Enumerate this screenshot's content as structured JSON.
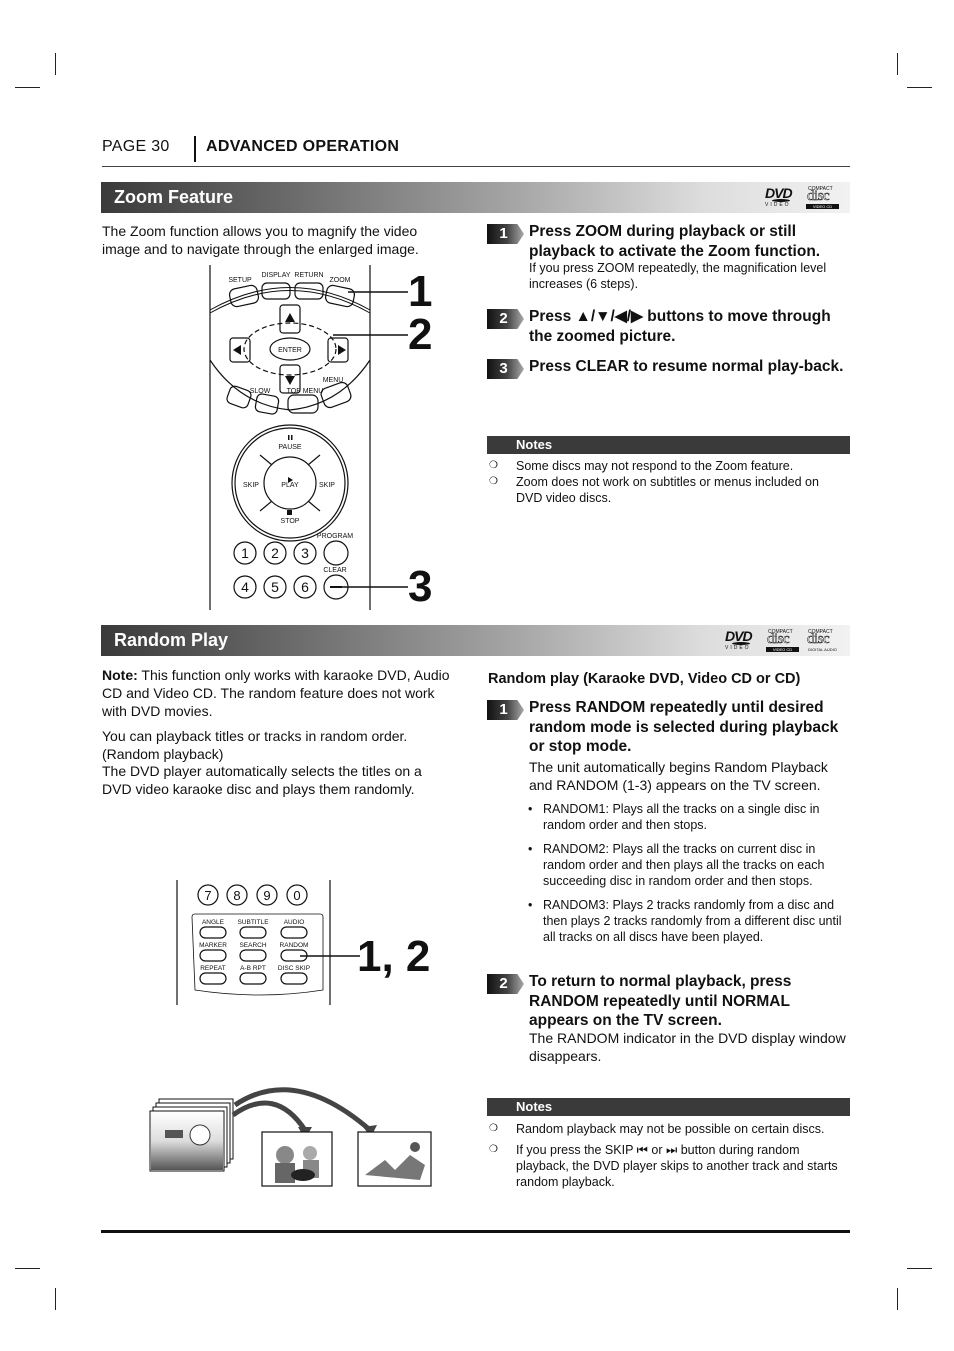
{
  "header": {
    "page_label": "PAGE 30",
    "section_title": "ADVANCED OPERATION"
  },
  "zoom_section": {
    "title": "Zoom Feature",
    "disc_logos": [
      "dvd-video-logo",
      "compact-disc-video-cd-logo"
    ],
    "intro": "The Zoom function allows you to magnify the video image and to navigate through the enlarged image.",
    "remote_labels": {
      "top_buttons": [
        "SETUP",
        "DISPLAY",
        "RETURN",
        "ZOOM"
      ],
      "enter": "ENTER",
      "slow": "SLOW",
      "top_menu": "TOP MENU",
      "menu": "MENU",
      "pause": "PAUSE",
      "play": "PLAY",
      "skip_back": "SKIP",
      "skip_fwd": "SKIP",
      "stop": "STOP",
      "program": "PROGRAM",
      "clear": "CLEAR",
      "digits_row1": [
        "1",
        "2",
        "3"
      ],
      "digits_row2": [
        "4",
        "5",
        "6"
      ]
    },
    "callouts": [
      "1",
      "2",
      "3"
    ],
    "steps": [
      {
        "number": "1",
        "heading": "Press ZOOM during playback or still playback to activate the Zoom function.",
        "detail": "If you press ZOOM repeatedly, the magnification level increases (6 steps)."
      },
      {
        "number": "2",
        "heading": "Press ▲/▼/◀/▶ buttons to move through the zoomed picture.",
        "detail": ""
      },
      {
        "number": "3",
        "heading": "Press CLEAR to resume normal play-back.",
        "detail": ""
      }
    ],
    "notes_title": "Notes",
    "notes": [
      "Some discs may not respond to the Zoom feature.",
      "Zoom does not work on subtitles or menus included on DVD video discs."
    ]
  },
  "random_section": {
    "title": "Random Play",
    "disc_logos": [
      "dvd-video-logo",
      "compact-disc-video-cd-logo",
      "compact-disc-digital-audio-logo"
    ],
    "note_label": "Note:",
    "note_text": " This function only works with karaoke DVD, Audio CD and Video CD. The random feature does not work with DVD movies.",
    "para1": "You can playback titles or tracks in random order. (Random playback)",
    "para2": "The DVD player automatically selects the titles on a DVD video karaoke disc and plays them randomly.",
    "subheading": "Random play (Karaoke DVD, Video CD or CD)",
    "remote_labels": {
      "digits": [
        "7",
        "8",
        "9",
        "0"
      ],
      "row1": [
        "ANGLE",
        "SUBTITLE",
        "AUDIO"
      ],
      "row2": [
        "MARKER",
        "SEARCH",
        "RANDOM"
      ],
      "row3": [
        "REPEAT",
        "A-B RPT",
        "DISC SKIP"
      ]
    },
    "callout": "1, 2",
    "steps": [
      {
        "number": "1",
        "heading": "Press RANDOM repeatedly until desired random mode is selected during playback or stop mode.",
        "detail": "The unit automatically begins Random Playback and RANDOM (1-3) appears on the TV screen."
      },
      {
        "number": "2",
        "heading": "To return to normal playback, press RANDOM repeatedly until NORMAL appears on the TV screen.",
        "detail": "The RANDOM indicator in the DVD display window disappears."
      }
    ],
    "modes": [
      "RANDOM1: Plays all the tracks on a single disc in random order and then stops.",
      "RANDOM2: Plays all the tracks on current disc in random order and then plays all the tracks on each succeeding disc in random order and then stops.",
      "RANDOM3: Plays 2 tracks randomly from a disc and then plays 2 tracks randomly from a different disc until all tracks on all discs have been played."
    ],
    "notes_title": "Notes",
    "notes": [
      "Random playback may not be possible on certain discs.",
      "If you press the SKIP ⏮ or ⏭ button during random playback, the DVD player skips to another track and starts random playback."
    ]
  }
}
